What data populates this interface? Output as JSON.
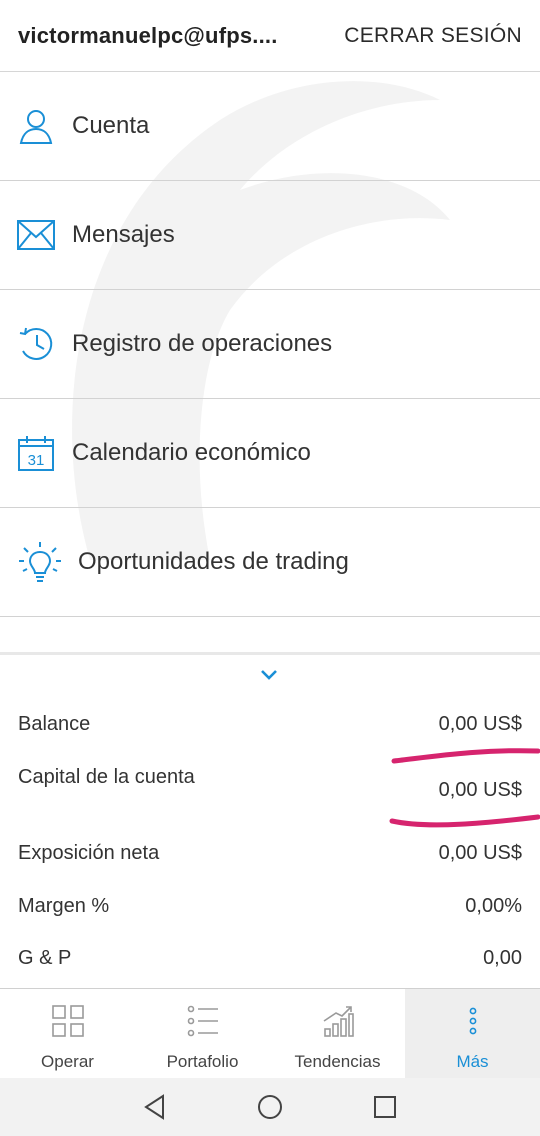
{
  "header": {
    "email": "victormanuelpc@ufps....",
    "logout_label": "CERRAR SESIÓN"
  },
  "menu": {
    "items": [
      {
        "label": "Cuenta",
        "icon": "user-icon"
      },
      {
        "label": "Mensajes",
        "icon": "envelope-icon"
      },
      {
        "label": "Registro de operaciones",
        "icon": "history-icon"
      },
      {
        "label": "Calendario económico",
        "icon": "calendar-icon",
        "calendar_day": "31"
      },
      {
        "label": "Oportunidades de trading",
        "icon": "lightbulb-icon"
      }
    ]
  },
  "summary": {
    "rows": [
      {
        "label": "Balance",
        "value": "0,00 US$"
      },
      {
        "label": "Capital de la cuenta",
        "value": "0,00 US$"
      },
      {
        "label": "Exposición neta",
        "value": "0,00 US$"
      },
      {
        "label": "Margen %",
        "value": "0,00%"
      },
      {
        "label": "G & P",
        "value": "0,00"
      }
    ]
  },
  "bottom_nav": {
    "tabs": [
      {
        "label": "Operar",
        "icon": "grid-icon",
        "active": false
      },
      {
        "label": "Portafolio",
        "icon": "list-icon",
        "active": false
      },
      {
        "label": "Tendencias",
        "icon": "trend-chart-icon",
        "active": false
      },
      {
        "label": "Más",
        "icon": "more-dots-icon",
        "active": true
      }
    ]
  },
  "colors": {
    "accent": "#1a8fd6",
    "annotation": "#d6246e",
    "divider": "#d2d2d2"
  }
}
